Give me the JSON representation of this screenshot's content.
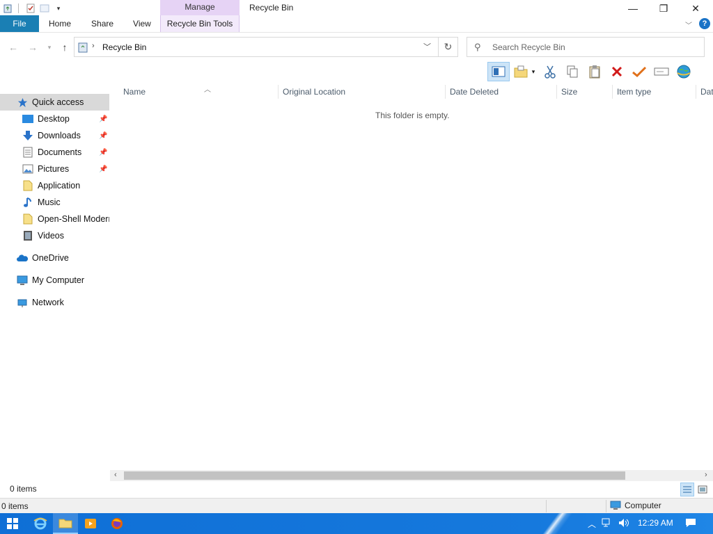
{
  "window": {
    "title": "Recycle Bin",
    "manage_label": "Manage",
    "contextual_tab": "Recycle Bin Tools",
    "tabs": [
      "File",
      "Home",
      "Share",
      "View"
    ],
    "controls": {
      "minimize": "—",
      "maximize": "❐",
      "close": "✕"
    }
  },
  "address": {
    "path": [
      "Recycle Bin"
    ],
    "search_placeholder": "Search Recycle Bin"
  },
  "sidebar": {
    "items": [
      {
        "label": "Quick access",
        "icon": "star-icon",
        "pinned": false
      },
      {
        "label": "Desktop",
        "icon": "desktop-icon",
        "pinned": true
      },
      {
        "label": "Downloads",
        "icon": "download-icon",
        "pinned": true
      },
      {
        "label": "Documents",
        "icon": "documents-icon",
        "pinned": true
      },
      {
        "label": "Pictures",
        "icon": "pictures-icon",
        "pinned": true
      },
      {
        "label": "Application",
        "icon": "folder-icon",
        "pinned": false
      },
      {
        "label": "Music",
        "icon": "music-icon",
        "pinned": false
      },
      {
        "label": "Open-Shell Modern",
        "icon": "folder-icon",
        "pinned": false
      },
      {
        "label": "Videos",
        "icon": "videos-icon",
        "pinned": false
      },
      {
        "label": "OneDrive",
        "icon": "cloud-icon",
        "pinned": false
      },
      {
        "label": "My Computer",
        "icon": "computer-icon",
        "pinned": false
      },
      {
        "label": "Network",
        "icon": "network-icon",
        "pinned": false
      }
    ]
  },
  "list": {
    "columns": [
      "Name",
      "Original Location",
      "Date Deleted",
      "Size",
      "Item type",
      "Dat"
    ],
    "empty_message": "This folder is empty."
  },
  "status": {
    "items_count": "0 items",
    "bottom_count": "0 items",
    "location": "Computer"
  },
  "taskbar": {
    "clock": "12:29 AM"
  },
  "colors": {
    "file_tab": "#1a7fb4",
    "manage_header": "#e6d3f5",
    "taskbar": "#1679dd",
    "selection": "#cce4f7"
  }
}
